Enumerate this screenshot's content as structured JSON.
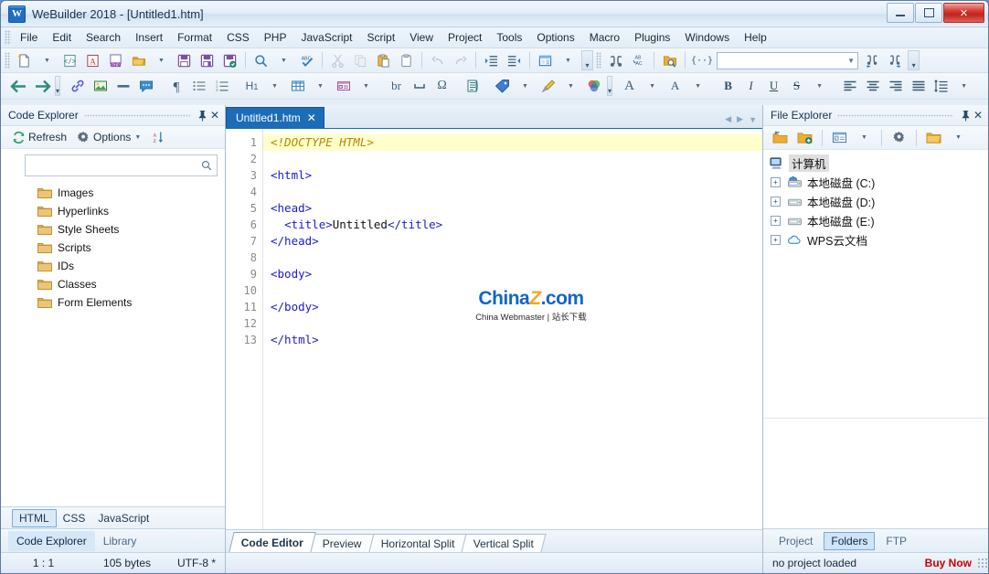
{
  "window": {
    "title": "WeBuilder 2018 - [Untitled1.htm]",
    "app_icon": "W",
    "minimize_label": "Minimize",
    "maximize_label": "Maximize",
    "close_label": "✕"
  },
  "menubar": [
    {
      "label": "File",
      "accel": "F"
    },
    {
      "label": "Edit",
      "accel": "E"
    },
    {
      "label": "Search",
      "accel": "S"
    },
    {
      "label": "Insert",
      "accel": "I"
    },
    {
      "label": "Format",
      "accel": "a"
    },
    {
      "label": "CSS",
      "accel": "C"
    },
    {
      "label": "PHP",
      "accel": ""
    },
    {
      "label": "JavaScript",
      "accel": ""
    },
    {
      "label": "Script",
      "accel": ""
    },
    {
      "label": "View",
      "accel": "V"
    },
    {
      "label": "Project",
      "accel": "P"
    },
    {
      "label": "Tools",
      "accel": "T"
    },
    {
      "label": "Options",
      "accel": "O"
    },
    {
      "label": "Macro",
      "accel": "a"
    },
    {
      "label": "Plugins",
      "accel": ""
    },
    {
      "label": "Windows",
      "accel": "W"
    },
    {
      "label": "Help",
      "accel": "H"
    }
  ],
  "toolbar_standard": {
    "items": [
      {
        "name": "new-file-icon",
        "glyph": "📄",
        "dropdown": true
      },
      {
        "name": "new-html-icon",
        "glyph": "⬜",
        "dropdown": false
      },
      {
        "name": "new-asp-icon",
        "glyph": "A",
        "dropdown": false
      },
      {
        "name": "new-php-icon",
        "glyph": "PHP",
        "dropdown": false
      },
      {
        "name": "open-folder-icon",
        "glyph": "📁",
        "dropdown": true
      },
      {
        "name": "save-icon",
        "glyph": "💾",
        "dropdown": false
      },
      {
        "name": "save-as-icon",
        "glyph": "💾",
        "dropdown": false
      },
      {
        "name": "save-all-icon",
        "glyph": "💾",
        "dropdown": false
      },
      {
        "name": "preview-icon",
        "glyph": "🔍",
        "dropdown": true
      },
      {
        "name": "spellcheck-icon",
        "glyph": "ABC",
        "dropdown": false
      },
      {
        "name": "cut-icon",
        "glyph": "✂",
        "dropdown": false
      },
      {
        "name": "copy-icon",
        "glyph": "⧉",
        "dropdown": false
      },
      {
        "name": "paste-icon",
        "glyph": "📋",
        "dropdown": false
      },
      {
        "name": "clipboard-icon",
        "glyph": "📋",
        "dropdown": false
      },
      {
        "name": "undo-icon",
        "glyph": "↶",
        "dropdown": false
      },
      {
        "name": "redo-icon",
        "glyph": "↷",
        "dropdown": false
      },
      {
        "name": "indent-icon",
        "glyph": "⇥",
        "dropdown": false
      },
      {
        "name": "outdent-icon",
        "glyph": "⇤",
        "dropdown": false
      },
      {
        "name": "code-template-icon",
        "glyph": "☷",
        "dropdown": true
      },
      {
        "name": "find-icon",
        "glyph": "🔎",
        "dropdown": false
      },
      {
        "name": "replace-icon",
        "glyph": "AB",
        "dropdown": false
      },
      {
        "name": "find-in-files-icon",
        "glyph": "📂",
        "dropdown": false
      },
      {
        "name": "snippet-icon",
        "glyph": "{..}",
        "dropdown": false
      },
      {
        "name": "find-previous-icon",
        "glyph": "⇦",
        "dropdown": false
      },
      {
        "name": "find-next-icon",
        "glyph": "⇨",
        "dropdown": false
      }
    ],
    "find_field_value": "",
    "find_field_placeholder": ""
  },
  "toolbar_html": {
    "items": [
      {
        "name": "back-icon",
        "glyph": "←"
      },
      {
        "name": "forward-icon",
        "glyph": "→"
      },
      {
        "name": "hyperlink-icon",
        "glyph": "🔗"
      },
      {
        "name": "image-icon",
        "glyph": "🖼"
      },
      {
        "name": "horizontal-rule-icon",
        "glyph": "—"
      },
      {
        "name": "comment-icon",
        "glyph": "💬"
      },
      {
        "name": "paragraph-icon",
        "glyph": "¶"
      },
      {
        "name": "unordered-list-icon",
        "glyph": "☰"
      },
      {
        "name": "ordered-list-icon",
        "glyph": "≡"
      },
      {
        "name": "heading-icon",
        "glyph": "H1",
        "dropdown": true
      },
      {
        "name": "table-icon",
        "glyph": "▦",
        "dropdown": true
      },
      {
        "name": "form-icon",
        "glyph": "▤",
        "dropdown": true
      },
      {
        "name": "line-break-icon",
        "glyph": "br"
      },
      {
        "name": "nbsp-icon",
        "glyph": "⌴"
      },
      {
        "name": "special-char-icon",
        "glyph": "Ω"
      },
      {
        "name": "stylesheet-icon",
        "glyph": "📜"
      },
      {
        "name": "tag-icon",
        "glyph": "🏷",
        "dropdown": true
      },
      {
        "name": "format-painter-icon",
        "glyph": "🖌",
        "dropdown": true
      },
      {
        "name": "color-picker-icon",
        "glyph": "◕"
      },
      {
        "name": "font-icon",
        "glyph": "A",
        "dropdown": true
      },
      {
        "name": "font-size-icon",
        "glyph": "A",
        "dropdown": true
      },
      {
        "name": "bold-icon",
        "glyph": "B"
      },
      {
        "name": "italic-icon",
        "glyph": "I"
      },
      {
        "name": "underline-icon",
        "glyph": "U"
      },
      {
        "name": "strikethrough-icon",
        "glyph": "S",
        "dropdown": true
      },
      {
        "name": "align-left-icon",
        "glyph": "≡"
      },
      {
        "name": "align-center-icon",
        "glyph": "≡"
      },
      {
        "name": "align-right-icon",
        "glyph": "≡"
      },
      {
        "name": "align-justify-icon",
        "glyph": "≡"
      },
      {
        "name": "line-spacing-icon",
        "glyph": "↕",
        "dropdown": true
      },
      {
        "name": "page-icon",
        "glyph": "⌸"
      },
      {
        "name": "text-color-icon",
        "glyph": "A"
      },
      {
        "name": "background-color-icon",
        "glyph": "◆"
      },
      {
        "name": "php-open-icon",
        "glyph": "{?}"
      },
      {
        "name": "braces-icon",
        "glyph": "{ }"
      },
      {
        "name": "php-close-icon",
        "glyph": "{?}"
      }
    ]
  },
  "code_explorer": {
    "title": "Code Explorer",
    "pin_icon": "📌",
    "close_icon": "✕",
    "refresh_label": "Refresh",
    "options_label": "Options",
    "sort_label": "A-Z sort",
    "search_value": "",
    "search_placeholder": "",
    "tree": [
      {
        "label": "Images",
        "icon": "folder-icon"
      },
      {
        "label": "Hyperlinks",
        "icon": "folder-icon"
      },
      {
        "label": "Style Sheets",
        "icon": "folder-icon"
      },
      {
        "label": "Scripts",
        "icon": "folder-icon"
      },
      {
        "label": "IDs",
        "icon": "folder-icon"
      },
      {
        "label": "Classes",
        "icon": "folder-icon"
      },
      {
        "label": "Form Elements",
        "icon": "folder-icon"
      }
    ],
    "lang_tabs": [
      {
        "label": "HTML",
        "active": true
      },
      {
        "label": "CSS",
        "active": false
      },
      {
        "label": "JavaScript",
        "active": false
      }
    ],
    "panel_tabs": [
      {
        "label": "Code Explorer",
        "active": true
      },
      {
        "label": "Library",
        "active": false
      }
    ]
  },
  "editor": {
    "document_tab": {
      "label": "Untitled1.htm",
      "close_icon": "✕"
    },
    "nav_prev_icon": "◀",
    "nav_next_icon": "▶",
    "nav_menu_icon": "▼",
    "line_numbers": [
      "1",
      "2",
      "3",
      "4",
      "5",
      "6",
      "7",
      "8",
      "9",
      "10",
      "11",
      "12",
      "13"
    ],
    "lines": [
      {
        "n": 1,
        "text": "<!DOCTYPE HTML>",
        "kind": "doctype",
        "highlight": true
      },
      {
        "n": 2,
        "text": "",
        "kind": "blank",
        "highlight": false
      },
      {
        "n": 3,
        "text": "<html>",
        "kind": "tag",
        "highlight": false
      },
      {
        "n": 4,
        "text": "",
        "kind": "blank",
        "highlight": false
      },
      {
        "n": 5,
        "text": "<head>",
        "kind": "tag",
        "highlight": false
      },
      {
        "n": 6,
        "text": "  <title>Untitled</title>",
        "kind": "mixed",
        "highlight": false
      },
      {
        "n": 7,
        "text": "</head>",
        "kind": "tag",
        "highlight": false
      },
      {
        "n": 8,
        "text": "",
        "kind": "blank",
        "highlight": false
      },
      {
        "n": 9,
        "text": "<body>",
        "kind": "tag",
        "highlight": false
      },
      {
        "n": 10,
        "text": "",
        "kind": "blank",
        "highlight": false
      },
      {
        "n": 11,
        "text": "</body>",
        "kind": "tag",
        "highlight": false
      },
      {
        "n": 12,
        "text": "",
        "kind": "blank",
        "highlight": false
      },
      {
        "n": 13,
        "text": "</html>",
        "kind": "tag",
        "highlight": false
      }
    ],
    "line6_parts": {
      "indent": "  ",
      "open": "<title>",
      "text": "Untitled",
      "close": "</title>"
    },
    "watermark": {
      "brand": "China",
      "brand_accent": "Z",
      "brand_tail": ".com",
      "subtitle": "China Webmaster | 站长下载"
    },
    "view_tabs": [
      {
        "label": "Code Editor",
        "active": true
      },
      {
        "label": "Preview",
        "active": false
      },
      {
        "label": "Horizontal Split",
        "active": false
      },
      {
        "label": "Vertical Split",
        "active": false
      }
    ]
  },
  "file_explorer": {
    "title": "File Explorer",
    "pin_icon": "📌",
    "close_icon": "✕",
    "toolbar": [
      {
        "name": "go-up-folder-icon",
        "glyph": "📁",
        "dropdown": false
      },
      {
        "name": "new-folder-icon",
        "glyph": "📁",
        "dropdown": false
      },
      {
        "name": "view-mode-icon",
        "glyph": "▤",
        "dropdown": true
      },
      {
        "name": "settings-gear-icon",
        "glyph": "⚙",
        "dropdown": false
      },
      {
        "name": "favorites-folder-icon",
        "glyph": "📁",
        "dropdown": true
      }
    ],
    "tree": [
      {
        "label": "计算机",
        "icon": "computer-icon",
        "expander": null,
        "root": true
      },
      {
        "label": "本地磁盘 (C:)",
        "icon": "system-drive-icon",
        "expander": "+",
        "root": false
      },
      {
        "label": "本地磁盘 (D:)",
        "icon": "drive-icon",
        "expander": "+",
        "root": false
      },
      {
        "label": "本地磁盘 (E:)",
        "icon": "drive-icon",
        "expander": "+",
        "root": false
      },
      {
        "label": "WPS云文档",
        "icon": "cloud-icon",
        "expander": "+",
        "root": false
      }
    ],
    "tabs": [
      {
        "label": "Project",
        "active": false
      },
      {
        "label": "Folders",
        "active": true
      },
      {
        "label": "FTP",
        "active": false
      }
    ]
  },
  "statusbar": {
    "caret_position": "1 : 1",
    "file_size": "105 bytes",
    "encoding": "UTF-8 *",
    "project_status": "no project loaded",
    "buy_now": "Buy Now"
  },
  "colors": {
    "accent_blue": "#1c6cb8",
    "tag_color": "#1a1ad2",
    "doctype_color": "#b08a00",
    "highlight_line": "#ffffcc",
    "buy_now_red": "#cc0000",
    "folder_yellow": "#e8b551"
  }
}
